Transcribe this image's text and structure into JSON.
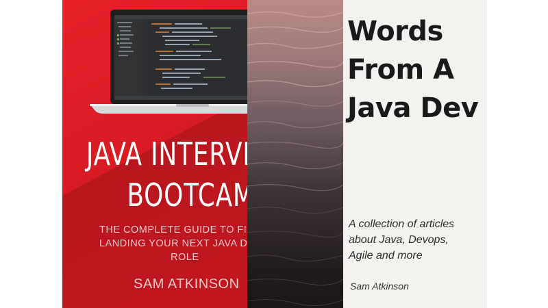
{
  "books": [
    {
      "title_lines": [
        "JAVA INTERVI",
        "BOOTCAMP"
      ],
      "subtitle_lines": [
        "THE COMPLETE GUIDE TO FINDING",
        "LANDING YOUR NEXT JAVA DEVELO",
        "ROLE"
      ],
      "author": "SAM ATKINSON",
      "colors": {
        "cover": "#e3201f",
        "text": "#ffffff",
        "subtext": "#f7c9cb"
      },
      "illustration": "laptop-with-code-editor"
    },
    {
      "title_lines": [
        "Words",
        "From A",
        "Java Dev"
      ],
      "subtitle_lines": [
        "A collection of articles",
        "about Java, Devops,",
        "Agile and more"
      ],
      "author": "Sam Atkinson",
      "colors": {
        "panel": "#f3f2ef",
        "text": "#1a1a1a"
      },
      "illustration": "water-surface-photo"
    }
  ]
}
